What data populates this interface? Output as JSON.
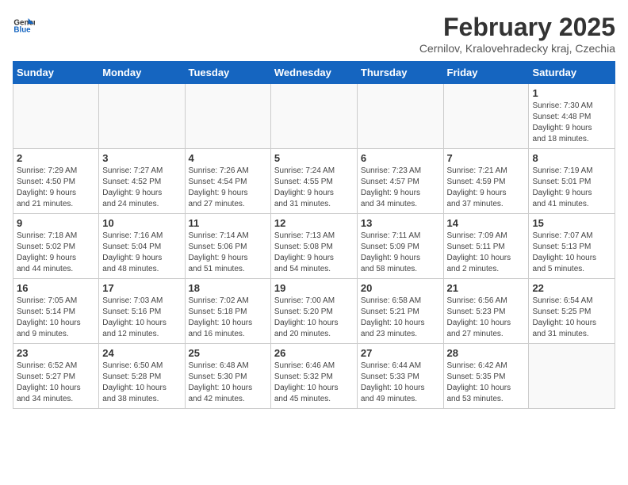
{
  "header": {
    "logo_general": "General",
    "logo_blue": "Blue",
    "month_title": "February 2025",
    "location": "Cernilov, Kralovehradecky kraj, Czechia"
  },
  "weekdays": [
    "Sunday",
    "Monday",
    "Tuesday",
    "Wednesday",
    "Thursday",
    "Friday",
    "Saturday"
  ],
  "weeks": [
    [
      {
        "num": "",
        "info": ""
      },
      {
        "num": "",
        "info": ""
      },
      {
        "num": "",
        "info": ""
      },
      {
        "num": "",
        "info": ""
      },
      {
        "num": "",
        "info": ""
      },
      {
        "num": "",
        "info": ""
      },
      {
        "num": "1",
        "info": "Sunrise: 7:30 AM\nSunset: 4:48 PM\nDaylight: 9 hours\nand 18 minutes."
      }
    ],
    [
      {
        "num": "2",
        "info": "Sunrise: 7:29 AM\nSunset: 4:50 PM\nDaylight: 9 hours\nand 21 minutes."
      },
      {
        "num": "3",
        "info": "Sunrise: 7:27 AM\nSunset: 4:52 PM\nDaylight: 9 hours\nand 24 minutes."
      },
      {
        "num": "4",
        "info": "Sunrise: 7:26 AM\nSunset: 4:54 PM\nDaylight: 9 hours\nand 27 minutes."
      },
      {
        "num": "5",
        "info": "Sunrise: 7:24 AM\nSunset: 4:55 PM\nDaylight: 9 hours\nand 31 minutes."
      },
      {
        "num": "6",
        "info": "Sunrise: 7:23 AM\nSunset: 4:57 PM\nDaylight: 9 hours\nand 34 minutes."
      },
      {
        "num": "7",
        "info": "Sunrise: 7:21 AM\nSunset: 4:59 PM\nDaylight: 9 hours\nand 37 minutes."
      },
      {
        "num": "8",
        "info": "Sunrise: 7:19 AM\nSunset: 5:01 PM\nDaylight: 9 hours\nand 41 minutes."
      }
    ],
    [
      {
        "num": "9",
        "info": "Sunrise: 7:18 AM\nSunset: 5:02 PM\nDaylight: 9 hours\nand 44 minutes."
      },
      {
        "num": "10",
        "info": "Sunrise: 7:16 AM\nSunset: 5:04 PM\nDaylight: 9 hours\nand 48 minutes."
      },
      {
        "num": "11",
        "info": "Sunrise: 7:14 AM\nSunset: 5:06 PM\nDaylight: 9 hours\nand 51 minutes."
      },
      {
        "num": "12",
        "info": "Sunrise: 7:13 AM\nSunset: 5:08 PM\nDaylight: 9 hours\nand 54 minutes."
      },
      {
        "num": "13",
        "info": "Sunrise: 7:11 AM\nSunset: 5:09 PM\nDaylight: 9 hours\nand 58 minutes."
      },
      {
        "num": "14",
        "info": "Sunrise: 7:09 AM\nSunset: 5:11 PM\nDaylight: 10 hours\nand 2 minutes."
      },
      {
        "num": "15",
        "info": "Sunrise: 7:07 AM\nSunset: 5:13 PM\nDaylight: 10 hours\nand 5 minutes."
      }
    ],
    [
      {
        "num": "16",
        "info": "Sunrise: 7:05 AM\nSunset: 5:14 PM\nDaylight: 10 hours\nand 9 minutes."
      },
      {
        "num": "17",
        "info": "Sunrise: 7:03 AM\nSunset: 5:16 PM\nDaylight: 10 hours\nand 12 minutes."
      },
      {
        "num": "18",
        "info": "Sunrise: 7:02 AM\nSunset: 5:18 PM\nDaylight: 10 hours\nand 16 minutes."
      },
      {
        "num": "19",
        "info": "Sunrise: 7:00 AM\nSunset: 5:20 PM\nDaylight: 10 hours\nand 20 minutes."
      },
      {
        "num": "20",
        "info": "Sunrise: 6:58 AM\nSunset: 5:21 PM\nDaylight: 10 hours\nand 23 minutes."
      },
      {
        "num": "21",
        "info": "Sunrise: 6:56 AM\nSunset: 5:23 PM\nDaylight: 10 hours\nand 27 minutes."
      },
      {
        "num": "22",
        "info": "Sunrise: 6:54 AM\nSunset: 5:25 PM\nDaylight: 10 hours\nand 31 minutes."
      }
    ],
    [
      {
        "num": "23",
        "info": "Sunrise: 6:52 AM\nSunset: 5:27 PM\nDaylight: 10 hours\nand 34 minutes."
      },
      {
        "num": "24",
        "info": "Sunrise: 6:50 AM\nSunset: 5:28 PM\nDaylight: 10 hours\nand 38 minutes."
      },
      {
        "num": "25",
        "info": "Sunrise: 6:48 AM\nSunset: 5:30 PM\nDaylight: 10 hours\nand 42 minutes."
      },
      {
        "num": "26",
        "info": "Sunrise: 6:46 AM\nSunset: 5:32 PM\nDaylight: 10 hours\nand 45 minutes."
      },
      {
        "num": "27",
        "info": "Sunrise: 6:44 AM\nSunset: 5:33 PM\nDaylight: 10 hours\nand 49 minutes."
      },
      {
        "num": "28",
        "info": "Sunrise: 6:42 AM\nSunset: 5:35 PM\nDaylight: 10 hours\nand 53 minutes."
      },
      {
        "num": "",
        "info": ""
      }
    ]
  ]
}
